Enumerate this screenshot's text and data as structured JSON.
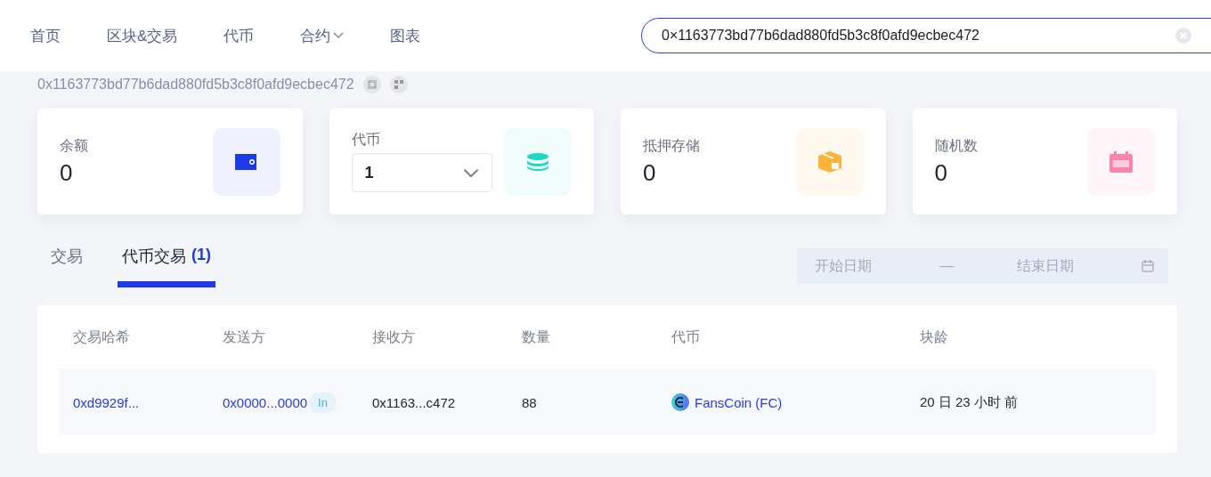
{
  "nav": {
    "items": [
      {
        "label": "首页",
        "dropdown": false
      },
      {
        "label": "区块&交易",
        "dropdown": false
      },
      {
        "label": "代币",
        "dropdown": false
      },
      {
        "label": "合约",
        "dropdown": true
      },
      {
        "label": "图表",
        "dropdown": false
      }
    ]
  },
  "search": {
    "value": "0×1163773bd77b6dad880fd5b3c8f0afd9ecbec472"
  },
  "address": "0x1163773bd77b6dad880fd5b3c8f0afd9ecbec472",
  "cards": [
    {
      "kind": "value",
      "label": "余额",
      "value": "0"
    },
    {
      "kind": "select",
      "label": "代币",
      "value": "1"
    },
    {
      "kind": "value",
      "label": "抵押存储",
      "value": "0"
    },
    {
      "kind": "value",
      "label": "随机数",
      "value": "0"
    }
  ],
  "tabs": [
    {
      "label": "交易",
      "selected": false
    },
    {
      "label": "代币交易",
      "count": "(1)",
      "selected": true
    }
  ],
  "date_range": {
    "start_placeholder": "开始日期",
    "separator": "—",
    "end_placeholder": "结束日期"
  },
  "table": {
    "columns": [
      "交易哈希",
      "发送方",
      "接收方",
      "数量",
      "代币",
      "块龄"
    ],
    "rows": [
      {
        "hash": "0xd9929f...",
        "from": "0x0000...0000",
        "direction": "In",
        "to": "0x1163...c472",
        "amount": "88",
        "token": "FansCoin (FC)",
        "age": "20 日 23 小时 前"
      }
    ]
  }
}
